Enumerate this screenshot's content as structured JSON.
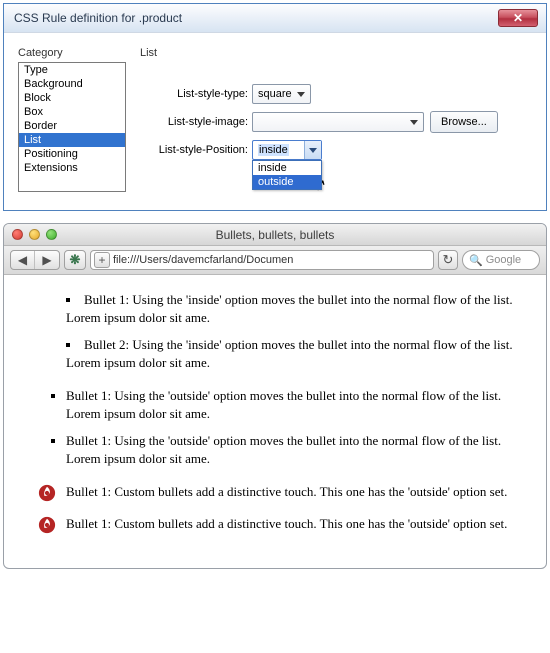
{
  "dialog": {
    "title": "CSS Rule definition for .product",
    "category_label": "Category",
    "right_label": "List",
    "categories": [
      "Type",
      "Background",
      "Block",
      "Box",
      "Border",
      "List",
      "Positioning",
      "Extensions"
    ],
    "selected_category": "List",
    "row_type_label": "List-style-type:",
    "type_value": "square",
    "row_image_label": "List-style-image:",
    "image_value": "",
    "browse_label": "Browse...",
    "row_pos_label": "List-style-Position:",
    "pos_value": "inside",
    "pos_options": [
      "inside",
      "outside"
    ],
    "pos_highlight": "outside"
  },
  "browser": {
    "window_title": "Bullets, bullets, bullets",
    "url": "file:///Users/davemcfarland/Documen",
    "search_placeholder": "Google",
    "inside_items": [
      "Bullet 1: Using the 'inside' option moves the bullet into the normal flow of the list. Lorem ipsum dolor sit ame.",
      "Bullet 2: Using the 'inside' option moves the bullet into the normal flow of the list. Lorem ipsum dolor sit ame."
    ],
    "outside_items": [
      "Bullet 1: Using the 'outside' option moves the bullet into the normal flow of the list. Lorem ipsum dolor sit ame.",
      "Bullet 1: Using the 'outside' option moves the bullet into the normal flow of the list. Lorem ipsum dolor sit ame."
    ],
    "custom_items": [
      "Bullet 1: Custom bullets add a distinctive touch. This one has the 'outside' option set.",
      "Bullet 1: Custom bullets add a distinctive touch. This one has the 'outside' option set."
    ]
  }
}
